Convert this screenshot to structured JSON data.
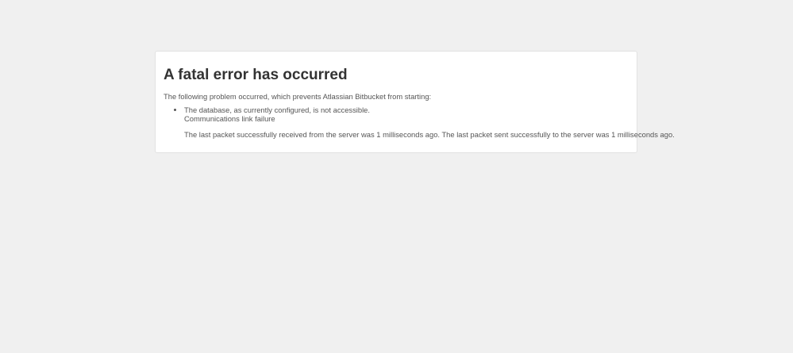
{
  "page": {
    "title": "A fatal error has occurred",
    "intro": "The following problem occurred, which prevents Atlassian Bitbucket from starting:",
    "problems": [
      {
        "message": "The database, as currently configured, is not accessible.",
        "detail": "Communications link failure",
        "extra": "The last packet successfully received from the server was 1 milliseconds ago. The last packet sent successfully to the server was 1 milliseconds ago."
      }
    ]
  },
  "colors": {
    "background": "#f0f0f0",
    "card": "#ffffff",
    "title": "#333333",
    "text": "#555555"
  }
}
